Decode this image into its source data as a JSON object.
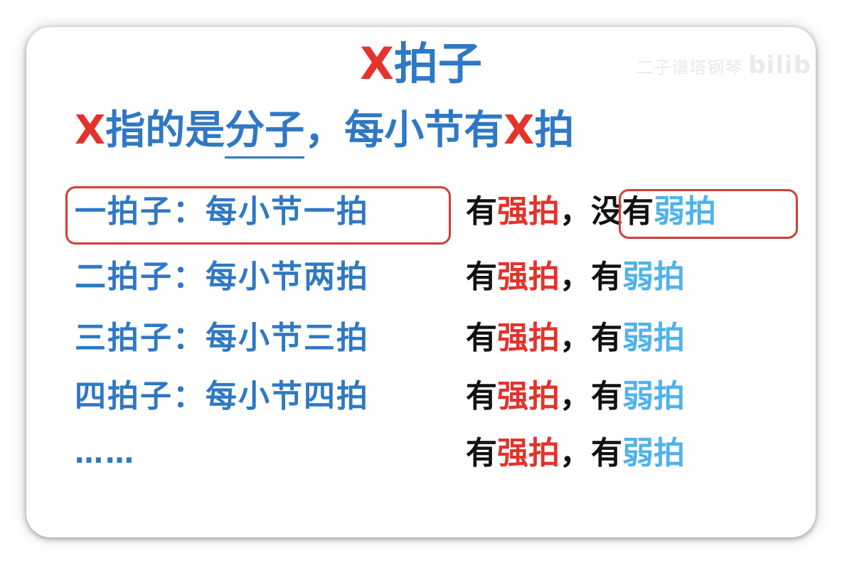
{
  "watermark": {
    "text": "二子谱塔钢琴",
    "logo": "bilib"
  },
  "title": {
    "x": "X",
    "rest": "拍子"
  },
  "subtitle": {
    "x1": "X",
    "t1": "指的是",
    "underlined": "分子",
    "t2": "，每小节有",
    "x2": "X",
    "t3": "拍"
  },
  "rows": [
    {
      "left": "一拍子：每小节一拍",
      "have1": "有",
      "strong": "强拍",
      "comma": "，",
      "have2": "没有",
      "weak": "弱拍"
    },
    {
      "left": "二拍子：每小节两拍",
      "have1": "有",
      "strong": "强拍",
      "comma": "，",
      "have2": "有",
      "weak": "弱拍"
    },
    {
      "left": "三拍子：每小节三拍",
      "have1": "有",
      "strong": "强拍",
      "comma": "，",
      "have2": "有",
      "weak": "弱拍"
    },
    {
      "left": "四拍子：每小节四拍",
      "have1": "有",
      "strong": "强拍",
      "comma": "，",
      "have2": "有",
      "weak": "弱拍"
    },
    {
      "left": "……",
      "have1": "有",
      "strong": "强拍",
      "comma": "，",
      "have2": "有",
      "weak": "弱拍"
    }
  ],
  "colors": {
    "red": "#e3332c",
    "blue": "#2f78c4",
    "light_blue": "#4fb3ea",
    "black": "#111111"
  }
}
